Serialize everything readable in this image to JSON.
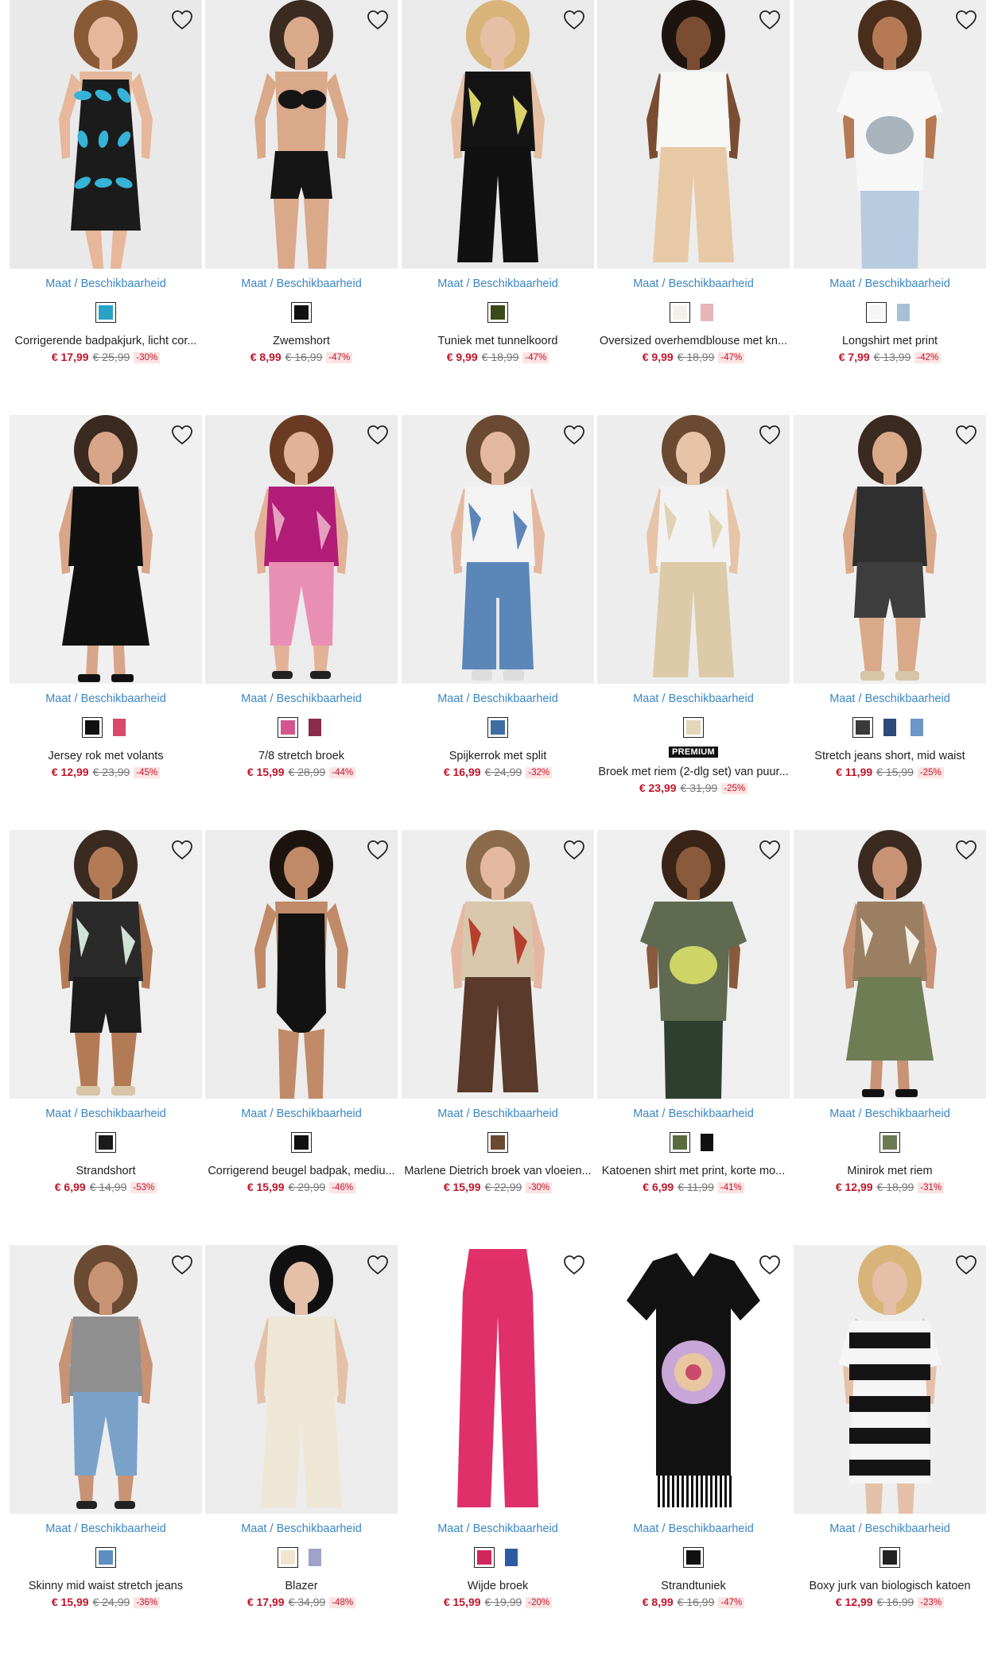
{
  "ui": {
    "size_label": "Maat",
    "availability_label": "Beschikbaarheid",
    "separator": "/"
  },
  "colors": {
    "accent_link": "#3a86c6",
    "price_red": "#c0152a",
    "discount_bg": "#fde3e3"
  },
  "products": [
    {
      "name": "Corrigerende badpakjurk, licht cor...",
      "price": "€ 17,99",
      "old_price": "€ 25,99",
      "discount": "-30%",
      "premium": "",
      "favorite_icon": "heart-outline-icon",
      "swatches": [
        {
          "color": "#2aa3c7",
          "selected": true
        }
      ],
      "photo": {
        "bg": "#e9e9e9",
        "skin": "#e6b79a",
        "hair": "#8a5a36",
        "top": "#1b1b1b",
        "top2": "#36b3d6",
        "bottom": "#1b1b1b",
        "shape": "dress"
      }
    },
    {
      "name": "Zwemshort",
      "price": "€ 8,99",
      "old_price": "€ 16,99",
      "discount": "-47%",
      "premium": "",
      "favorite_icon": "heart-outline-icon",
      "swatches": [
        {
          "color": "#111111",
          "selected": true
        }
      ],
      "photo": {
        "bg": "#ececec",
        "skin": "#d9a98a",
        "hair": "#3a2a20",
        "top": "#151515",
        "top2": "#151515",
        "bottom": "#151515",
        "shape": "bikini"
      }
    },
    {
      "name": "Tuniek met tunnelkoord",
      "price": "€ 9,99",
      "old_price": "€ 18,99",
      "discount": "-47%",
      "premium": "",
      "favorite_icon": "heart-outline-icon",
      "swatches": [
        {
          "color": "#3a4a1a",
          "selected": true
        }
      ],
      "photo": {
        "bg": "#eaeaea",
        "skin": "#e6c0a4",
        "hair": "#d8b47a",
        "top": "#141414",
        "top2": "#d9d36a",
        "bottom": "#111111",
        "shape": "pants"
      }
    },
    {
      "name": "Oversized overhemdblouse met kn...",
      "price": "€ 9,99",
      "old_price": "€ 18,99",
      "discount": "-47%",
      "premium": "",
      "favorite_icon": "heart-outline-icon",
      "swatches": [
        {
          "color": "#f4f1ec",
          "selected": true
        },
        {
          "color": "#e8b5b8",
          "selected": false
        }
      ],
      "photo": {
        "bg": "#ececec",
        "skin": "#7a4d33",
        "hair": "#1d1410",
        "top": "#f7f7f5",
        "top2": "#f7f7f5",
        "bottom": "#e8c9a6",
        "shape": "pants"
      }
    },
    {
      "name": "Longshirt met print",
      "price": "€ 7,99",
      "old_price": "€ 13,99",
      "discount": "-42%",
      "premium": "",
      "favorite_icon": "heart-outline-icon",
      "swatches": [
        {
          "color": "#f6f6f6",
          "selected": true
        },
        {
          "color": "#a9bfd6",
          "selected": false
        }
      ],
      "photo": {
        "bg": "#eeeeee",
        "skin": "#b57a55",
        "hair": "#4a2e1c",
        "top": "#f7f7f7",
        "top2": "#9aa7b0",
        "bottom": "#b9cbe0",
        "shape": "tee"
      }
    },
    {
      "name": "Jersey rok met volants",
      "price": "€ 12,99",
      "old_price": "€ 23,99",
      "discount": "-45%",
      "premium": "",
      "favorite_icon": "heart-outline-icon",
      "swatches": [
        {
          "color": "#111111",
          "selected": true
        },
        {
          "color": "#d94a68",
          "selected": false
        }
      ],
      "photo": {
        "bg": "#f0f0f0",
        "skin": "#d8a589",
        "hair": "#3a2a20",
        "top": "#111111",
        "top2": "#111111",
        "bottom": "#111111",
        "shape": "skirt"
      }
    },
    {
      "name": "7/8 stretch broek",
      "price": "€ 15,99",
      "old_price": "€ 28,99",
      "discount": "-44%",
      "premium": "",
      "favorite_icon": "heart-outline-icon",
      "swatches": [
        {
          "color": "#d4558e",
          "selected": true
        },
        {
          "color": "#8b2b4a",
          "selected": false
        }
      ],
      "photo": {
        "bg": "#ececec",
        "skin": "#e2b298",
        "hair": "#6a3a22",
        "top": "#b21d77",
        "top2": "#e5a0c0",
        "bottom": "#e98fb4",
        "shape": "capri"
      }
    },
    {
      "name": "Spijkerrok met split",
      "price": "€ 16,99",
      "old_price": "€ 24,99",
      "discount": "-32%",
      "premium": "",
      "favorite_icon": "heart-outline-icon",
      "swatches": [
        {
          "color": "#3f6ea3",
          "selected": true
        }
      ],
      "photo": {
        "bg": "#eeeeee",
        "skin": "#e4b8a0",
        "hair": "#6a4a32",
        "top": "#f3f3f3",
        "top2": "#5d86b8",
        "bottom": "#5b86b8",
        "shape": "longskirt"
      }
    },
    {
      "name": "Broek met riem (2-dlg set) van puur...",
      "price": "€ 23,99",
      "old_price": "€ 31,99",
      "discount": "-25%",
      "premium": "PREMIUM",
      "favorite_icon": "heart-outline-icon",
      "swatches": [
        {
          "color": "#e4d6b9",
          "selected": true
        }
      ],
      "photo": {
        "bg": "#ededed",
        "skin": "#e7c3a7",
        "hair": "#6a4a32",
        "top": "#f2f2f2",
        "top2": "#e0d2b4",
        "bottom": "#dccaa8",
        "shape": "pants"
      }
    },
    {
      "name": "Stretch jeans short, mid waist",
      "price": "€ 11,99",
      "old_price": "€ 15,99",
      "discount": "-25%",
      "premium": "",
      "favorite_icon": "heart-outline-icon",
      "swatches": [
        {
          "color": "#3a3a3a",
          "selected": true
        },
        {
          "color": "#2d4a78",
          "selected": false
        },
        {
          "color": "#6b96c7",
          "selected": false
        }
      ],
      "photo": {
        "bg": "#f0f0f0",
        "skin": "#d9a98a",
        "hair": "#3a2a20",
        "top": "#2f2f2f",
        "top2": "#2f2f2f",
        "bottom": "#3d3d3d",
        "shape": "shorts"
      }
    },
    {
      "name": "Strandshort",
      "price": "€ 6,99",
      "old_price": "€ 14,99",
      "discount": "-53%",
      "premium": "",
      "favorite_icon": "heart-outline-icon",
      "swatches": [
        {
          "color": "#1a1a1a",
          "selected": true
        }
      ],
      "photo": {
        "bg": "#efefef",
        "skin": "#b37a56",
        "hair": "#3a2a20",
        "top": "#2a2a2a",
        "top2": "#cfe3d6",
        "bottom": "#1c1c1c",
        "shape": "shorts"
      }
    },
    {
      "name": "Corrigerend beugel badpak, mediu...",
      "price": "€ 15,99",
      "old_price": "€ 29,99",
      "discount": "-46%",
      "premium": "",
      "favorite_icon": "heart-outline-icon",
      "swatches": [
        {
          "color": "#111111",
          "selected": true
        }
      ],
      "photo": {
        "bg": "#ececec",
        "skin": "#c08a68",
        "hair": "#1d1410",
        "top": "#121212",
        "top2": "#121212",
        "bottom": "#121212",
        "shape": "swimsuit"
      }
    },
    {
      "name": "Marlene Dietrich broek van vloeien...",
      "price": "€ 15,99",
      "old_price": "€ 22,99",
      "discount": "-30%",
      "premium": "",
      "favorite_icon": "heart-outline-icon",
      "swatches": [
        {
          "color": "#6b4a32",
          "selected": true
        }
      ],
      "photo": {
        "bg": "#eeeeee",
        "skin": "#e4b8a0",
        "hair": "#8a6a4a",
        "top": "#d8c7ad",
        "top2": "#b6402e",
        "bottom": "#5a3a2a",
        "shape": "pants"
      }
    },
    {
      "name": "Katoenen shirt met print, korte mo...",
      "price": "€ 6,99",
      "old_price": "€ 11,99",
      "discount": "-41%",
      "premium": "",
      "favorite_icon": "heart-outline-icon",
      "swatches": [
        {
          "color": "#5b6b3f",
          "selected": true
        },
        {
          "color": "#111111",
          "selected": false
        }
      ],
      "photo": {
        "bg": "#efefef",
        "skin": "#8a5a3c",
        "hair": "#3a2418",
        "top": "#5f6a50",
        "top2": "#dfe86a",
        "bottom": "#2f3f2f",
        "shape": "tee"
      }
    },
    {
      "name": "Minirok met riem",
      "price": "€ 12,99",
      "old_price": "€ 18,99",
      "discount": "-31%",
      "premium": "",
      "favorite_icon": "heart-outline-icon",
      "swatches": [
        {
          "color": "#6b7a52",
          "selected": true
        }
      ],
      "photo": {
        "bg": "#eeeeee",
        "skin": "#c89275",
        "hair": "#3a2a20",
        "top": "#9b7f63",
        "top2": "#f1efe6",
        "bottom": "#6f7d55",
        "shape": "skirt"
      }
    },
    {
      "name": "Skinny mid waist stretch jeans",
      "price": "€ 15,99",
      "old_price": "€ 24,99",
      "discount": "-36%",
      "premium": "",
      "favorite_icon": "heart-outline-icon",
      "swatches": [
        {
          "color": "#5d8fc2",
          "selected": true
        }
      ],
      "photo": {
        "bg": "#eeeeee",
        "skin": "#c89275",
        "hair": "#6a4a32",
        "top": "#8f8f8f",
        "top2": "#8f8f8f",
        "bottom": "#7aa2c9",
        "shape": "capri"
      }
    },
    {
      "name": "Blazer",
      "price": "€ 17,99",
      "old_price": "€ 34,99",
      "discount": "-48%",
      "premium": "",
      "favorite_icon": "heart-outline-icon",
      "swatches": [
        {
          "color": "#efe6d2",
          "selected": true
        },
        {
          "color": "#9fa2c9",
          "selected": false
        }
      ],
      "photo": {
        "bg": "#ececec",
        "skin": "#e4c0a8",
        "hair": "#111111",
        "top": "#efe7d6",
        "top2": "#efe7d6",
        "bottom": "#efe7d6",
        "shape": "pants"
      }
    },
    {
      "name": "Wijde broek",
      "price": "€ 15,99",
      "old_price": "€ 19,99",
      "discount": "-20%",
      "premium": "",
      "favorite_icon": "heart-outline-icon",
      "swatches": [
        {
          "color": "#d1265b",
          "selected": true
        },
        {
          "color": "#2d5aa0",
          "selected": false
        }
      ],
      "photo": {
        "bg": "#ffffff",
        "skin": "#ffffff",
        "hair": "#ffffff",
        "top": "#ffffff",
        "top2": "#ffffff",
        "bottom": "#e0306a",
        "shape": "flatpants"
      }
    },
    {
      "name": "Strandtuniek",
      "price": "€ 8,99",
      "old_price": "€ 16,99",
      "discount": "-47%",
      "premium": "",
      "favorite_icon": "heart-outline-icon",
      "swatches": [
        {
          "color": "#111111",
          "selected": true
        }
      ],
      "photo": {
        "bg": "#ffffff",
        "skin": "#ffffff",
        "hair": "#ffffff",
        "top": "#121212",
        "top2": "#c9a6d8",
        "bottom": "#121212",
        "shape": "flattunic"
      }
    },
    {
      "name": "Boxy jurk van biologisch katoen",
      "price": "€ 12,99",
      "old_price": "€ 16,99",
      "discount": "-23%",
      "premium": "",
      "favorite_icon": "heart-outline-icon",
      "swatches": [
        {
          "color": "#222222",
          "selected": true
        }
      ],
      "photo": {
        "bg": "#eeeeee",
        "skin": "#e4c0a8",
        "hair": "#d8b47a",
        "top": "#141414",
        "top2": "#f5f5f5",
        "bottom": "#141414",
        "shape": "stripedress"
      }
    }
  ]
}
